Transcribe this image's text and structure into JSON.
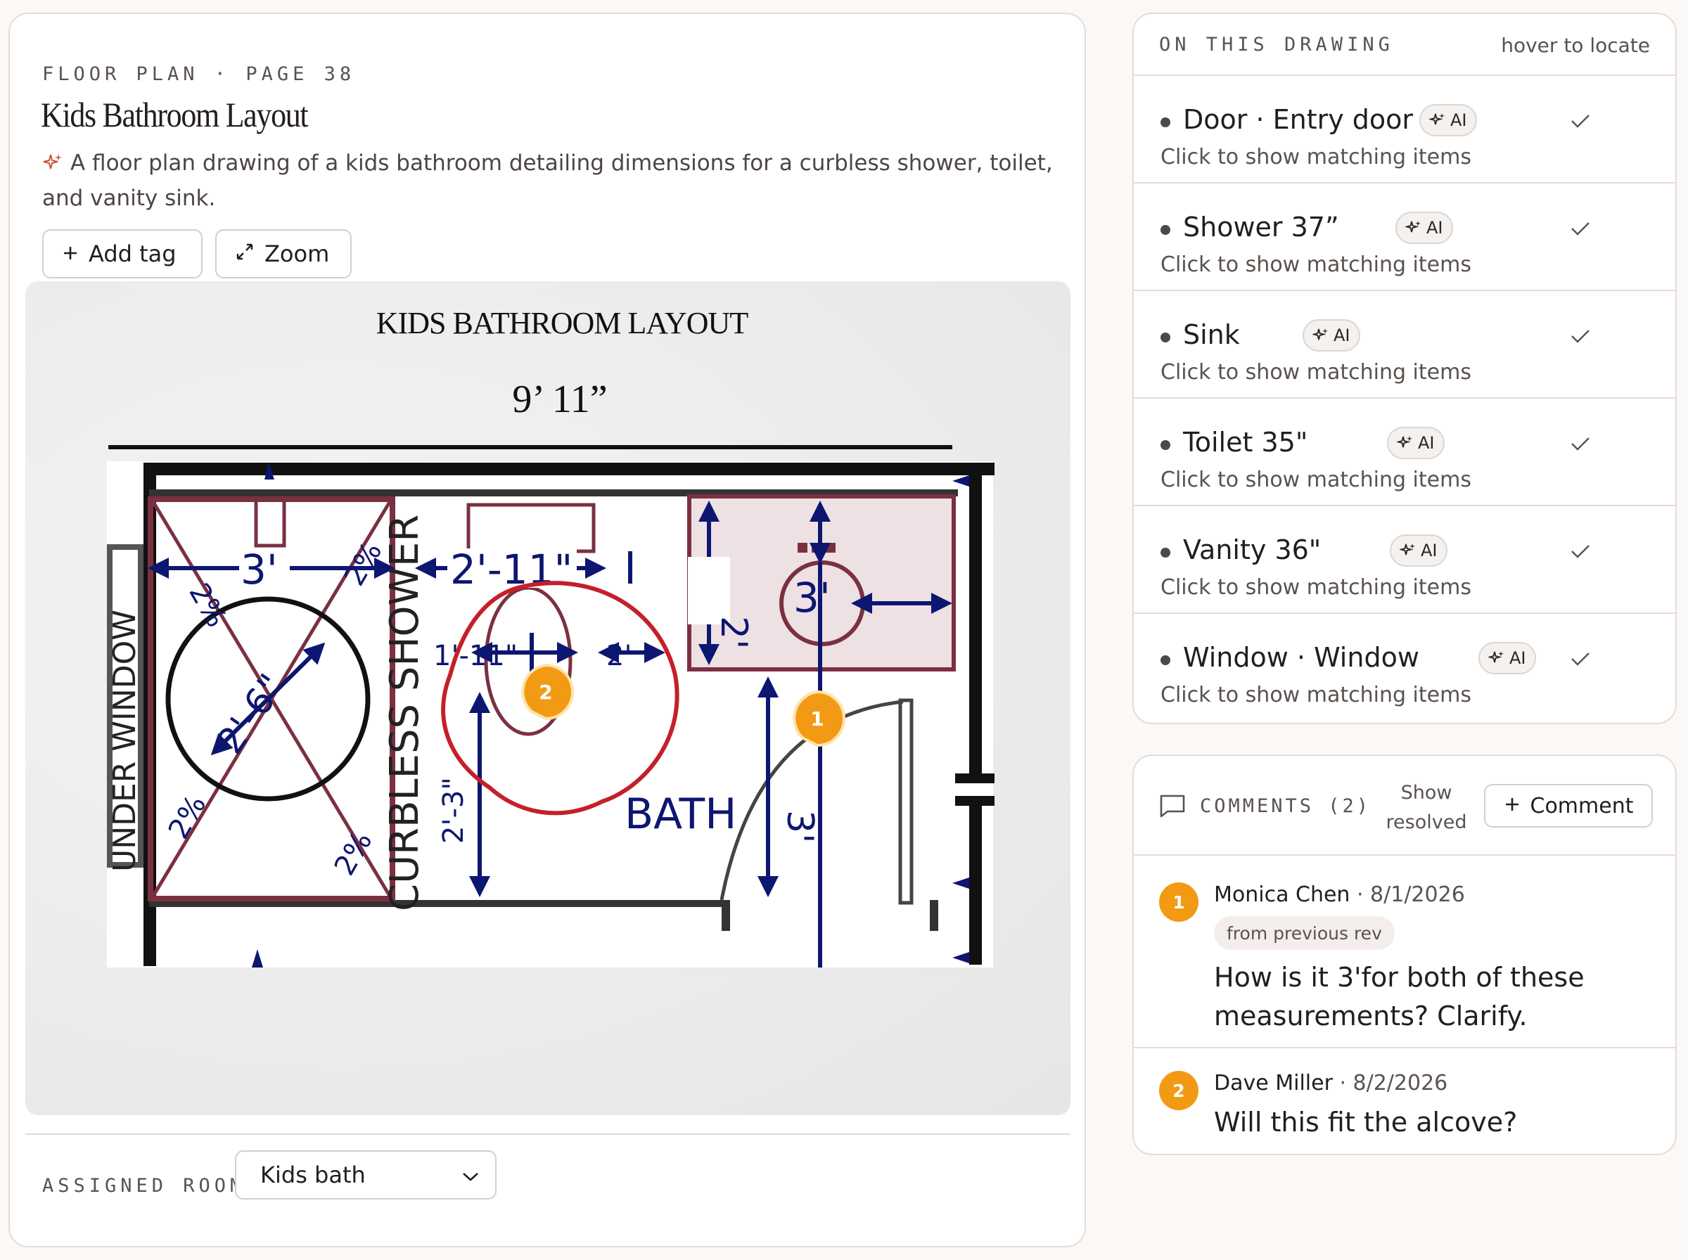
{
  "header": {
    "eyebrow": "FLOOR PLAN · PAGE 38",
    "title": "Kids Bathroom Layout",
    "summary": "A floor plan drawing of a kids bathroom detailing dimensions for a curbless shower, toilet, and vanity sink."
  },
  "toolbar": {
    "add_tag_label": "Add tag",
    "zoom_label": "Zoom"
  },
  "plan": {
    "heading": "KIDS BATHROOM LAYOUT",
    "overall_width": "9’ 11”",
    "labels": {
      "shower_width": "3'",
      "toilet_width": "2'-11\"",
      "vanity_depth": "2'",
      "sink_width": "3'",
      "shower_diameter": "2'-6\"",
      "toilet_clear": "1'-11\"",
      "toilet_side": "2'",
      "toilet_depth": "2'-3\"",
      "door_clear": "3'",
      "slope_1": "2%",
      "slope_2": "2%",
      "slope_3": "2%",
      "slope_4": "2%",
      "window_label": "UNDER WINDOW",
      "shower_label": "CURBLESS SHOWER",
      "room_label": "BATH"
    },
    "markers": [
      "2",
      "1"
    ]
  },
  "assigned_room": {
    "label": "ASSIGNED ROOM",
    "value": "Kids bath"
  },
  "on_drawing": {
    "title": "ON THIS DRAWING",
    "hint": "hover to locate",
    "ai_label": "AI",
    "items": [
      {
        "name": "Door · Entry door",
        "sub": "Click to show matching items"
      },
      {
        "name": "Shower 37”",
        "sub": "Click to show matching items"
      },
      {
        "name": "Sink",
        "sub": "Click to show matching items"
      },
      {
        "name": "Toilet 35\"",
        "sub": "Click to show matching items"
      },
      {
        "name": "Vanity 36\"",
        "sub": "Click to show matching items"
      },
      {
        "name": "Window · Window",
        "sub": "Click to show matching items"
      }
    ]
  },
  "comments": {
    "title": "COMMENTS (2)",
    "show_resolved": "Show resolved",
    "add_label": "Comment",
    "items": [
      {
        "pin": "1",
        "author": "Monica Chen",
        "date": " · 8/1/2026",
        "tag": "from previous rev",
        "body": "How is it 3'for both of these measurements? Clarify."
      },
      {
        "pin": "2",
        "author": "Dave Miller",
        "date": " · 8/2/2026",
        "body": "Will this fit the alcove?"
      }
    ]
  },
  "colors": {
    "accent": "#f29a14",
    "ink_navy": "#0d1670",
    "wall_maroon": "#7b3040",
    "markup_red": "#c4202a"
  }
}
